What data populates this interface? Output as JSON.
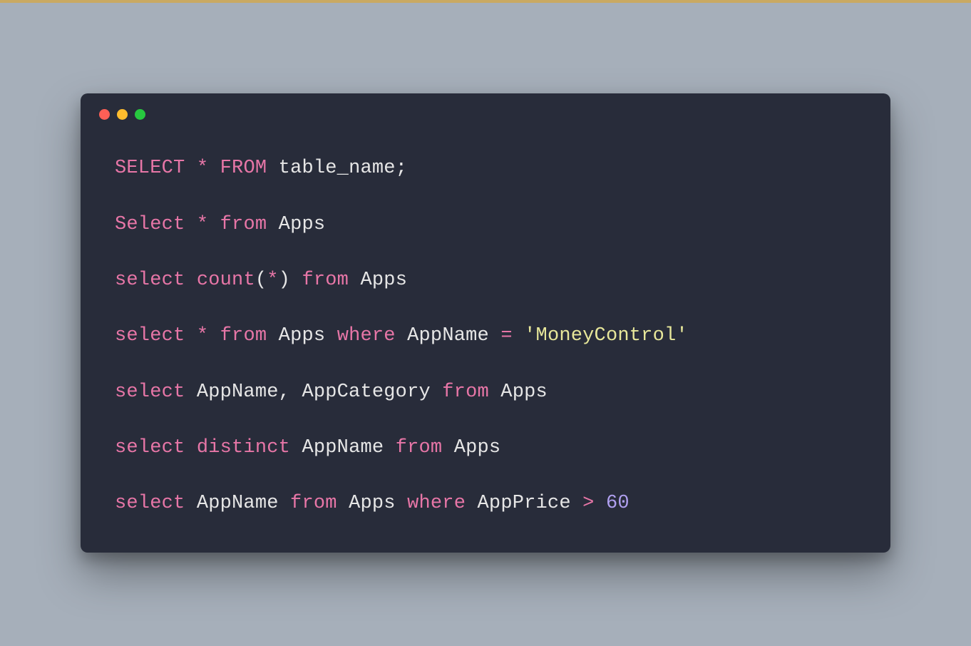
{
  "window": {
    "traffic_lights": [
      "close",
      "minimize",
      "zoom"
    ]
  },
  "code": {
    "lines": [
      [
        {
          "t": "SELECT",
          "c": "keyword"
        },
        {
          "t": " ",
          "c": "plain"
        },
        {
          "t": "*",
          "c": "star"
        },
        {
          "t": " ",
          "c": "plain"
        },
        {
          "t": "FROM",
          "c": "keyword"
        },
        {
          "t": " table_name;",
          "c": "plain"
        }
      ],
      [
        {
          "t": "Select",
          "c": "keyword"
        },
        {
          "t": " ",
          "c": "plain"
        },
        {
          "t": "*",
          "c": "star"
        },
        {
          "t": " ",
          "c": "plain"
        },
        {
          "t": "from",
          "c": "keyword"
        },
        {
          "t": " Apps",
          "c": "plain"
        }
      ],
      [
        {
          "t": "select",
          "c": "keyword"
        },
        {
          "t": " ",
          "c": "plain"
        },
        {
          "t": "count",
          "c": "func"
        },
        {
          "t": "(",
          "c": "punc"
        },
        {
          "t": "*",
          "c": "star"
        },
        {
          "t": ")",
          "c": "punc"
        },
        {
          "t": " ",
          "c": "plain"
        },
        {
          "t": "from",
          "c": "keyword"
        },
        {
          "t": " Apps",
          "c": "plain"
        }
      ],
      [
        {
          "t": "select",
          "c": "keyword"
        },
        {
          "t": " ",
          "c": "plain"
        },
        {
          "t": "*",
          "c": "star"
        },
        {
          "t": " ",
          "c": "plain"
        },
        {
          "t": "from",
          "c": "keyword"
        },
        {
          "t": " Apps ",
          "c": "plain"
        },
        {
          "t": "where",
          "c": "keyword"
        },
        {
          "t": " AppName ",
          "c": "plain"
        },
        {
          "t": "=",
          "c": "op"
        },
        {
          "t": " ",
          "c": "plain"
        },
        {
          "t": "'MoneyControl'",
          "c": "string"
        }
      ],
      [
        {
          "t": "select",
          "c": "keyword"
        },
        {
          "t": " AppName, AppCategory ",
          "c": "plain"
        },
        {
          "t": "from",
          "c": "keyword"
        },
        {
          "t": " Apps",
          "c": "plain"
        }
      ],
      [
        {
          "t": "select",
          "c": "keyword"
        },
        {
          "t": " ",
          "c": "plain"
        },
        {
          "t": "distinct",
          "c": "keyword"
        },
        {
          "t": " AppName ",
          "c": "plain"
        },
        {
          "t": "from",
          "c": "keyword"
        },
        {
          "t": " Apps",
          "c": "plain"
        }
      ],
      [
        {
          "t": "select",
          "c": "keyword"
        },
        {
          "t": " AppName ",
          "c": "plain"
        },
        {
          "t": "from",
          "c": "keyword"
        },
        {
          "t": " Apps ",
          "c": "plain"
        },
        {
          "t": "where",
          "c": "keyword"
        },
        {
          "t": " AppPrice ",
          "c": "plain"
        },
        {
          "t": ">",
          "c": "op"
        },
        {
          "t": " ",
          "c": "plain"
        },
        {
          "t": "60",
          "c": "number"
        }
      ]
    ]
  }
}
